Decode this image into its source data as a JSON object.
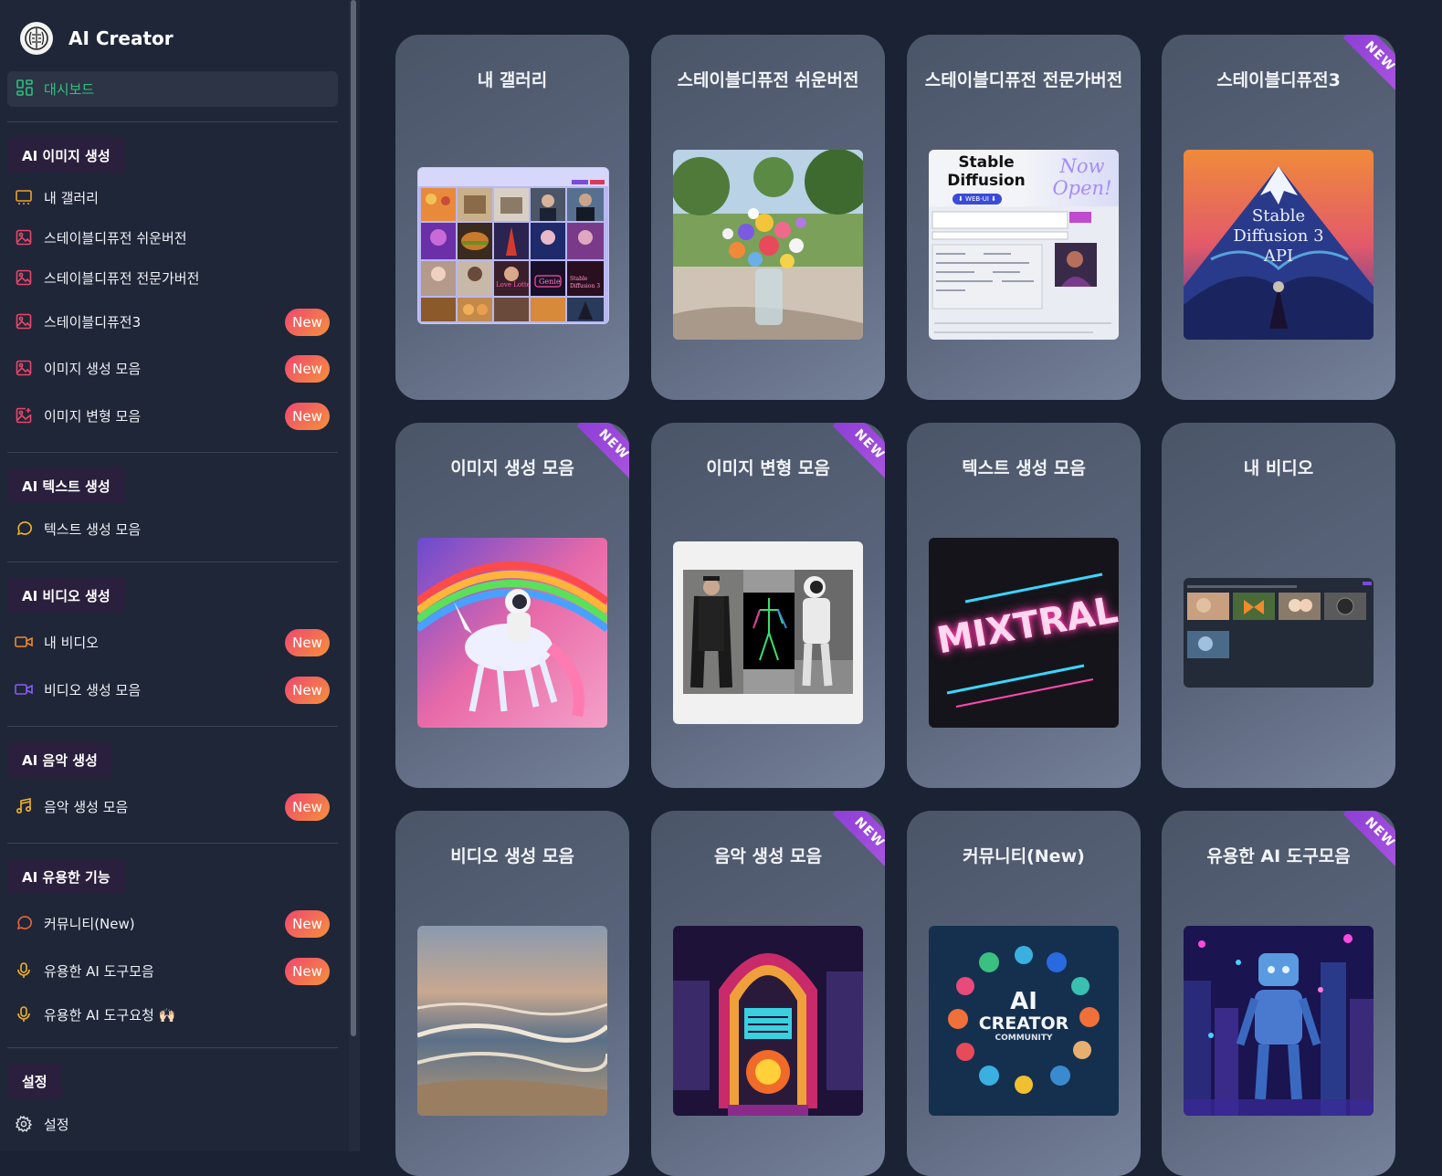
{
  "brand": {
    "title": "AI Creator"
  },
  "dashboard": {
    "label": "대시보드"
  },
  "sidebar": {
    "sections": [
      {
        "label": "AI 이미지 생성"
      },
      {
        "label": "AI 텍스트 생성"
      },
      {
        "label": "AI 비디오 생성"
      },
      {
        "label": "AI 음악 생성"
      },
      {
        "label": "AI 유용한 기능"
      },
      {
        "label": "설정"
      }
    ],
    "items": [
      {
        "label": "내 갤러리",
        "icon": "gallery-icon",
        "color": "#f0a02c"
      },
      {
        "label": "스테이블디퓨전 쉬운버전",
        "icon": "image-icon",
        "color": "#e8466a"
      },
      {
        "label": "스테이블디퓨전 전문가버전",
        "icon": "image-icon",
        "color": "#e8466a"
      },
      {
        "label": "스테이블디퓨전3",
        "icon": "image-icon",
        "color": "#e8466a",
        "badge": "New"
      },
      {
        "label": "이미지 생성 모음",
        "icon": "image-icon",
        "color": "#e8466a",
        "badge": "New"
      },
      {
        "label": "이미지 변형 모음",
        "icon": "image-plus-icon",
        "color": "#e8466a",
        "badge": "New"
      },
      {
        "label": "텍스트 생성 모음",
        "icon": "chat-bubble-icon",
        "color": "#f0b429"
      },
      {
        "label": "내 비디오",
        "icon": "video-camera-icon",
        "color": "#f08a2c",
        "badge": "New"
      },
      {
        "label": "비디오 생성 모음",
        "icon": "video-camera-icon",
        "color": "#8b5cf6",
        "badge": "New"
      },
      {
        "label": "음악 생성 모음",
        "icon": "music-note-icon",
        "color": "#f0b429",
        "badge": "New"
      },
      {
        "label": "커뮤니티(New)",
        "icon": "chat-bubble-icon",
        "color": "#e8663a",
        "badge": "New"
      },
      {
        "label": "유용한 AI 도구모음",
        "icon": "microphone-icon",
        "color": "#f0b429",
        "badge": "New"
      },
      {
        "label": "유용한 AI 도구요청 🙌🏻",
        "icon": "microphone-icon",
        "color": "#f0b429"
      },
      {
        "label": "설정",
        "icon": "gear-icon",
        "color": "#d9dce3"
      }
    ]
  },
  "cards": [
    {
      "title": "내 갤러리"
    },
    {
      "title": "스테이블디퓨전 쉬운버전"
    },
    {
      "title": "스테이블디퓨전 전문가버전",
      "thumb_text": {
        "left": "Stable Diffusion",
        "pill": "⬇ WEB-UI ⬇",
        "right": "Now Open!"
      }
    },
    {
      "title": "스테이블디퓨전3",
      "ribbon": "NEW",
      "thumb_text": "Stable Diffusion 3 API"
    },
    {
      "title": "이미지 생성 모음",
      "ribbon": "NEW"
    },
    {
      "title": "이미지 변형 모음",
      "ribbon": "NEW"
    },
    {
      "title": "텍스트 생성 모음",
      "thumb_text": "MIXTRAL"
    },
    {
      "title": "내 비디오"
    },
    {
      "title": "비디오 생성 모음"
    },
    {
      "title": "음악 생성 모음",
      "ribbon": "NEW"
    },
    {
      "title": "커뮤니티(New)",
      "thumb_text": {
        "big": "AI",
        "mid": "CREATOR",
        "small": "COMMUNITY"
      }
    },
    {
      "title": "유용한 AI 도구모음",
      "ribbon": "NEW"
    }
  ],
  "gallery_thumb": {
    "labels": [
      "Love Lotte",
      "Genie",
      "Stable Diffusion 3"
    ]
  },
  "badge_label": "New",
  "colors": {
    "sidebar_bg": "#1f2638",
    "main_bg": "#1b2233",
    "accent_green": "#2ec27e",
    "section_bg": "#2a1f3d",
    "ribbon": "#9a48db"
  }
}
